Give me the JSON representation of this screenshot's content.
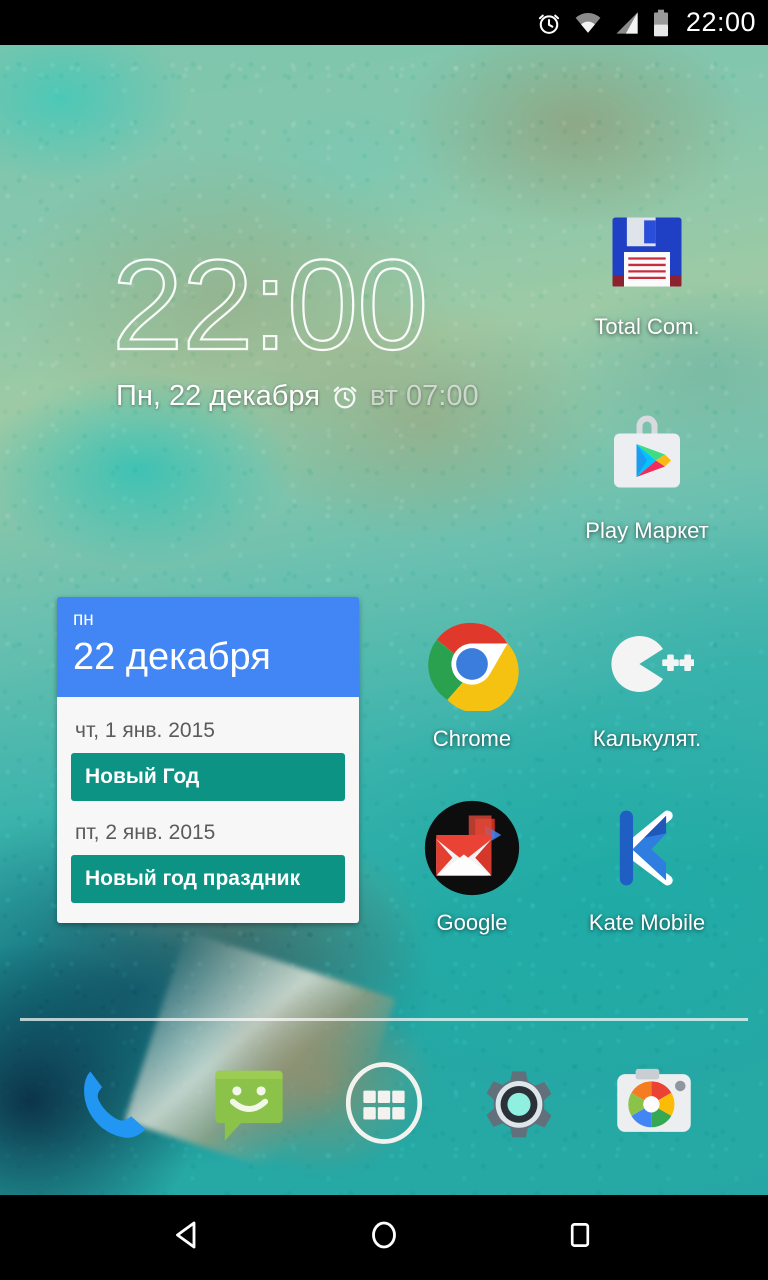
{
  "status_bar": {
    "clock": "22:00",
    "icons": [
      {
        "name": "alarm-icon",
        "label": "alarm set"
      },
      {
        "name": "wifi-icon",
        "label": "wifi connected"
      },
      {
        "name": "cellular-signal-icon",
        "label": "cellular signal"
      },
      {
        "name": "battery-icon",
        "label": "battery"
      }
    ]
  },
  "clock_widget": {
    "time": "22:00",
    "date": "Пн, 22 декабря",
    "alarm": "вт 07:00",
    "alarm_icon": "alarm-clock-icon"
  },
  "calendar_widget": {
    "header_day_of_week": "пн",
    "header_date": "22 декабря",
    "header_color": "#4285F4",
    "event_color": "#0c9384",
    "entries": [
      {
        "day": "чт, 1 янв. 2015",
        "event": "Новый Год"
      },
      {
        "day": "пт, 2 янв. 2015",
        "event": "Новый год праздник"
      }
    ]
  },
  "apps": [
    {
      "id": "total-commander",
      "label": "Total Com.",
      "icon": "floppy-disk-icon"
    },
    {
      "id": "play-market",
      "label": "Play Маркет",
      "icon": "play-store-icon"
    },
    {
      "id": "chrome",
      "label": "Chrome",
      "icon": "chrome-icon"
    },
    {
      "id": "calculator",
      "label": "Калькулят.",
      "icon": "calculator-cpp-icon"
    },
    {
      "id": "google-folder",
      "label": "Google",
      "icon": "gmail-folder-icon"
    },
    {
      "id": "kate-mobile",
      "label": "Kate Mobile",
      "icon": "kate-mobile-k-icon"
    }
  ],
  "dock": [
    {
      "id": "phone",
      "label": "Phone",
      "icon": "phone-icon"
    },
    {
      "id": "messaging",
      "label": "Messaging",
      "icon": "messaging-smiley-icon"
    },
    {
      "id": "app-drawer",
      "label": "All apps",
      "icon": "app-drawer-icon"
    },
    {
      "id": "settings",
      "label": "Settings",
      "icon": "gear-icon"
    },
    {
      "id": "camera",
      "label": "Camera",
      "icon": "camera-icon"
    }
  ],
  "nav_bar": [
    {
      "id": "back",
      "label": "Back",
      "icon": "back-triangle-icon"
    },
    {
      "id": "home",
      "label": "Home",
      "icon": "home-circle-icon"
    },
    {
      "id": "recents",
      "label": "Recents",
      "icon": "recents-square-icon"
    }
  ]
}
